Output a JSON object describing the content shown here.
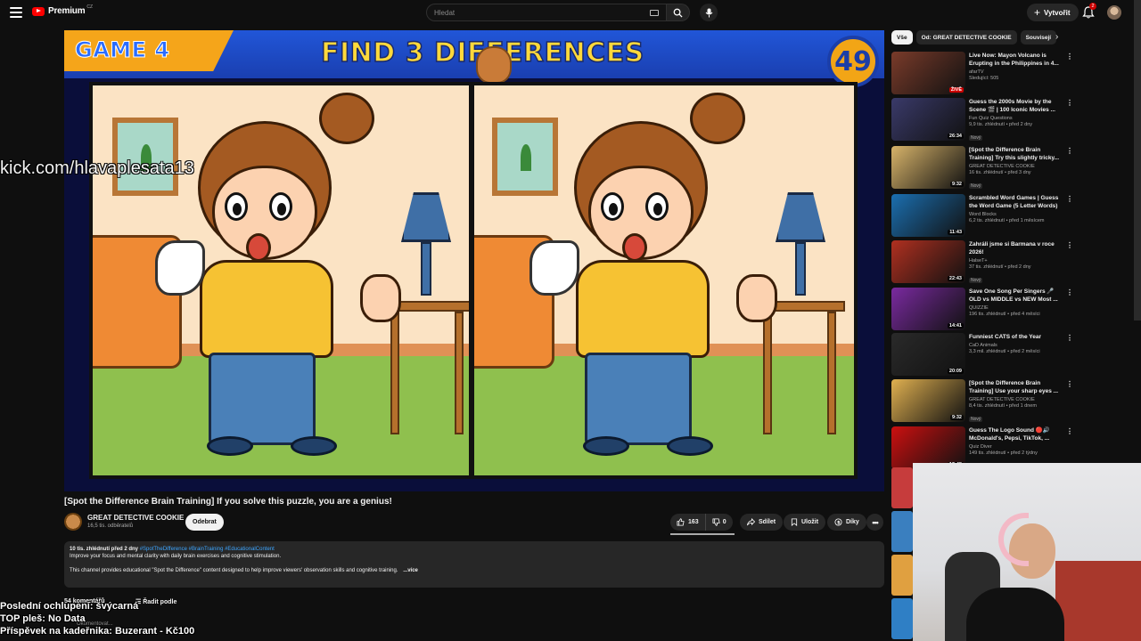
{
  "header": {
    "logo_text": "Premium",
    "logo_region": "CZ",
    "search_placeholder": "Hledat",
    "create_label": "Vytvořit",
    "notifications_count": "2"
  },
  "video": {
    "game_label": "GAME 4",
    "headline": "FIND 3 DIFFERENCES",
    "timer": "49",
    "title": "[Spot the Difference Brain Training] If you solve this puzzle, you are a genius!"
  },
  "channel": {
    "name": "GREAT DETECTIVE COOKIE",
    "subscribers": "16,5 tis. odběratelů",
    "subscribe_label": "Odebrat"
  },
  "actions": {
    "likes": "163",
    "dislikes": "0",
    "share": "Sdílet",
    "save": "Uložit",
    "thanks": "Díky"
  },
  "description": {
    "stats": "10 tis. zhlédnutí  před 2 dny",
    "tags": "#SpotTheDifference #BrainTraining #EducationalContent",
    "line1": "Improve your focus and mental clarity with daily brain exercises and cognitive stimulation.",
    "line2": "This channel provides educational \"Spot the Difference\" content designed to help improve viewers' observation skills and cognitive training.",
    "more": "...více"
  },
  "comments": {
    "count_label": "54 komentářů",
    "sort_label": "Řadit podle",
    "placeholder": "Okomentovat..."
  },
  "overlays": {
    "kick": "kick.com/hlavaplesata13",
    "line1": "Poslední ochlupení: švýcarná",
    "line2": "TOP pleš: No Data",
    "line3": "Příspěvek na kadeřnika: Buzerant - Kč100"
  },
  "chips": [
    "Vše",
    "Od: GREAT DETECTIVE COOKIE",
    "Souvisejí"
  ],
  "recommendations": [
    {
      "title": "Live Now: Mayon Volcano is Erupting in the Philippines in 4...",
      "channel": "afarTV",
      "meta": "Sledující: 505",
      "badge": "ŽIVĚ",
      "is_live": true
    },
    {
      "title": "Guess the 2000s Movie by the Scene 🎬 | 100 Iconic Movies ...",
      "channel": "Fun Quiz Questions",
      "meta": "9,9 tis. zhlédnutí • před 2 dny",
      "badge": "26:34",
      "new": "Nový"
    },
    {
      "title": "[Spot the Difference Brain Training] Try this slightly tricky...",
      "channel": "GREAT DETECTIVE COOKIE",
      "meta": "16 tis. zhlédnutí • před 3 dny",
      "badge": "9:32",
      "new": "Nový"
    },
    {
      "title": "Scrambled Word Games | Guess the Word Game (5 Letter Words)",
      "channel": "Word Blocks",
      "meta": "6,2 tis. zhlédnutí • před 1 měsícem",
      "badge": "11:43"
    },
    {
      "title": "Zahráli jsme si Barmana v roce 2026!",
      "channel": "HalseT+",
      "meta": "37 tis. zhlédnutí • před 2 dny",
      "badge": "22:43",
      "new": "Nový"
    },
    {
      "title": "Save One Song Per Singers 🎤 OLD vs MIDDLE vs NEW Most ...",
      "channel": "QUIZZIE",
      "meta": "196 tis. zhlédnutí • před 4 měsíci",
      "badge": "14:41"
    },
    {
      "title": "Funniest CATS of the Year",
      "channel": "CaD Animals",
      "meta": "3,3 mil. zhlédnutí • před 2 měsíci",
      "badge": "20:09"
    },
    {
      "title": "[Spot the Difference Brain Training] Use your sharp eyes ...",
      "channel": "GREAT DETECTIVE COOKIE",
      "meta": "8,4 tis. zhlédnutí • před 1 dnem",
      "badge": "9:32",
      "new": "Nový"
    },
    {
      "title": "Guess The Logo Sound 🔴🔊 McDonald's, Pepsi, TikTok, ...",
      "channel": "Quiz Diver",
      "meta": "149 tis. zhlédnutí • před 2 týdny",
      "badge": "13:48"
    }
  ],
  "thumb_colors": [
    "#7a3b2a",
    "#3a3a6a",
    "#d8b46a",
    "#1b6fb0",
    "#b03020",
    "#7a2aa0",
    "#2a2a2a",
    "#e0b050",
    "#cc1010"
  ]
}
